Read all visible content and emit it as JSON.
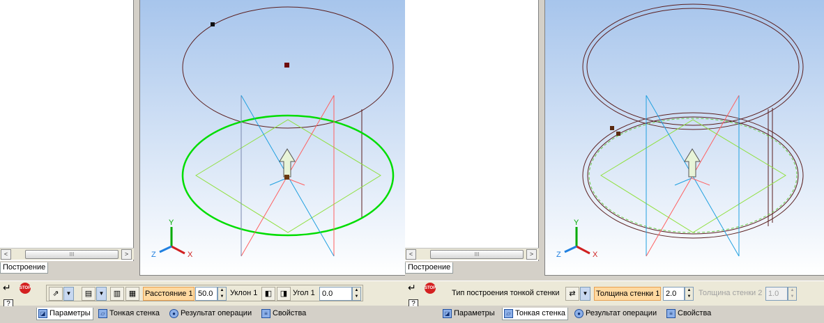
{
  "panel_left": {
    "tree_tab_label": "Построение",
    "params": {
      "distance_label": "Расстояние 1",
      "distance_value": "50.0",
      "slope_label": "Уклон 1",
      "angle_label": "Угол 1",
      "angle_value": "0.0"
    },
    "tabs": [
      "Параметры",
      "Тонкая стенка",
      "Результат операции",
      "Свойства"
    ]
  },
  "panel_right": {
    "tree_tab_label": "Построение",
    "params": {
      "thin_wall_type_label": "Тип построения тонкой стенки",
      "thickness1_label": "Толщина стенки 1",
      "thickness1_value": "2.0",
      "thickness2_label": "Толщина стенки 2",
      "thickness2_value": "1.0"
    },
    "tabs": [
      "Параметры",
      "Тонкая стенка",
      "Результат операции",
      "Свойства"
    ]
  },
  "common": {
    "stop_icon_text": "STOP",
    "help_icon_text": "?",
    "enter_icon_text": "↵",
    "scroll_left": "<",
    "scroll_right": ">",
    "scroll_thumb": "III",
    "axis_x": "X",
    "axis_y": "Y",
    "axis_z": "Z"
  },
  "colors": {
    "viewport_top": "#a7c5ec",
    "sketch_green": "#00dd00",
    "body_outline": "#5a1e1e",
    "plane_red": "#ff6060",
    "plane_cyan": "#20a0e0",
    "plane_green": "#90e040",
    "highlight": "#ffd9a0"
  },
  "icons": [
    "enter-icon",
    "stop-icon",
    "help-icon",
    "direction-icon",
    "dropdown-icon",
    "tree-icon",
    "reverse-icon",
    "extrude-icon",
    "spin-icon",
    "thin-wall-icon"
  ]
}
